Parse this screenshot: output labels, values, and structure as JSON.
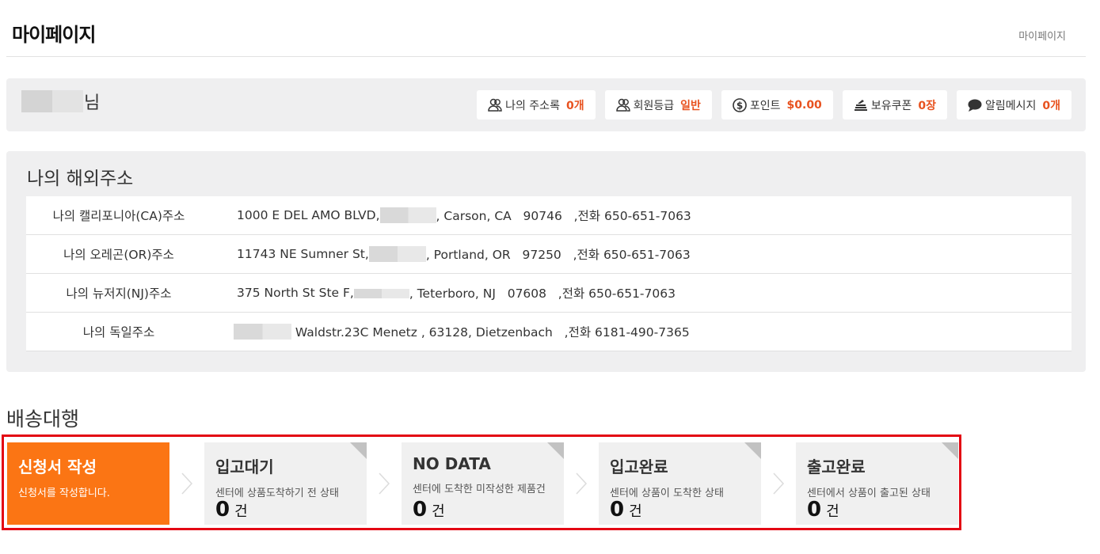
{
  "header": {
    "title": "마이페이지",
    "breadcrumb": "마이페이지"
  },
  "user": {
    "suffix": "님"
  },
  "stats": [
    {
      "icon": "users-icon",
      "label": "나의 주소록",
      "value": "0개"
    },
    {
      "icon": "users-icon",
      "label": "회원등급",
      "value": "일반"
    },
    {
      "icon": "dollar-coin-icon",
      "label": "포인트",
      "value": "$0.00"
    },
    {
      "icon": "coupon-stack-icon",
      "label": "보유쿠폰",
      "value": "0장"
    },
    {
      "icon": "speech-bubble-icon",
      "label": "알림메시지",
      "value": "0개"
    }
  ],
  "addresses": {
    "title": "나의 해외주소",
    "rows": [
      {
        "label": "나의 캘리포니아(CA)주소",
        "before": "1000 E DEL AMO BLVD,",
        "after": ", Carson, CA   90746   ,전화 650-651-7063"
      },
      {
        "label": "나의 오레곤(OR)주소",
        "before": "11743 NE Sumner St,",
        "after": ", Portland, OR   97250   ,전화 650-651-7063"
      },
      {
        "label": "나의 뉴저지(NJ)주소",
        "before": "375 North St Ste F,",
        "after": ", Teterboro, NJ   07608   ,전화 650-651-7063"
      },
      {
        "label": "나의 독일주소",
        "before": "",
        "after": " Waldstr.23C Menetz , 63128, Dietzenbach   ,전화 6181-490-7365"
      }
    ]
  },
  "shipping": {
    "title": "배송대행",
    "steps": [
      {
        "title": "신청서 작성",
        "desc": "신청서를 작성합니다.",
        "count": "",
        "unit": ""
      },
      {
        "title": "입고대기",
        "desc": "센터에 상품도착하기 전 상태",
        "count": "0",
        "unit": "건"
      },
      {
        "title": "NO DATA",
        "desc": "센터에 도착한 미작성한 제품건",
        "count": "0",
        "unit": "건"
      },
      {
        "title": "입고완료",
        "desc": "센터에 상품이 도착한 상태",
        "count": "0",
        "unit": "건"
      },
      {
        "title": "출고완료",
        "desc": "센터에서 상품이 출고된 상태",
        "count": "0",
        "unit": "건"
      }
    ]
  },
  "colors": {
    "accent": "#fb7514",
    "value_text": "#e8521f",
    "highlight_border": "#e30613"
  }
}
